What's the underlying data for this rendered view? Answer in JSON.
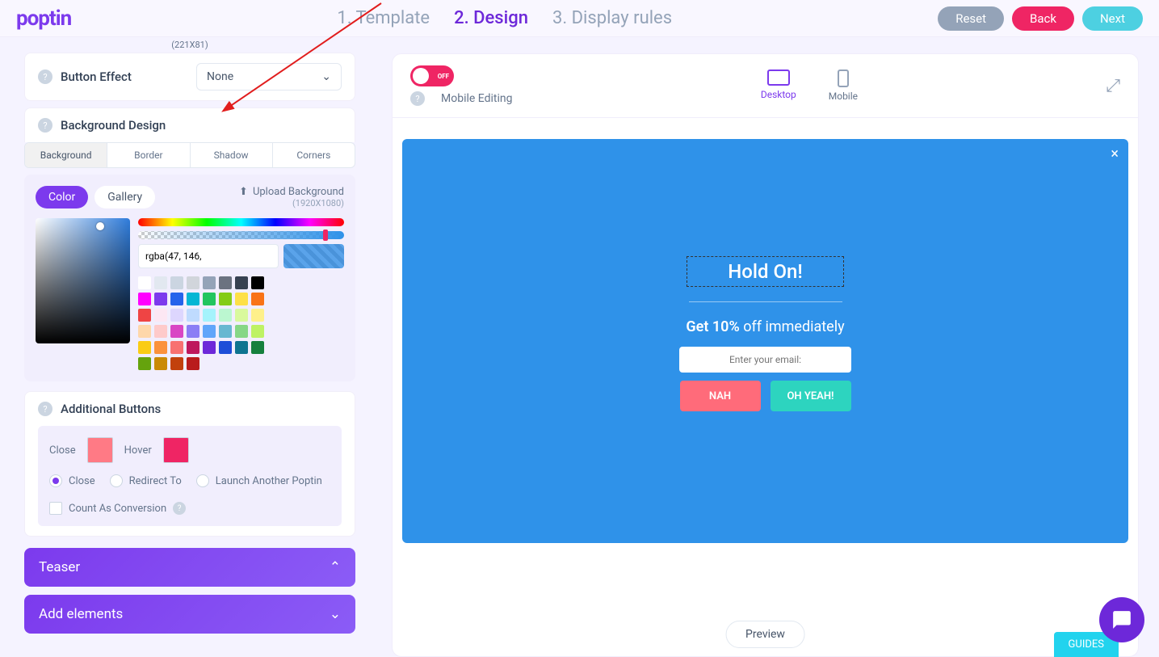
{
  "header": {
    "logo": "poptin",
    "steps": [
      "1. Template",
      "2. Design",
      "3. Display rules"
    ],
    "activeStep": 1,
    "reset": "Reset",
    "back": "Back",
    "next": "Next"
  },
  "sidebar": {
    "sizeHint": "(221X81)",
    "buttonEffect": {
      "label": "Button Effect",
      "value": "None"
    },
    "backgroundDesign": {
      "label": "Background Design",
      "tabs": [
        "Background",
        "Border",
        "Shadow",
        "Corners"
      ],
      "activeTab": 0,
      "colorChip": "Color",
      "galleryChip": "Gallery",
      "uploadLabel": "Upload Background",
      "uploadHint": "(1920X1080)",
      "colorValue": "rgba(47, 146,",
      "swatches": [
        "#ffffff",
        "#e2e8f0",
        "#cbd5e1",
        "#d1d5db",
        "#94a3b8",
        "#6b7280",
        "#374151",
        "#000000",
        "#ff00ff",
        "#7c3aed",
        "#2563eb",
        "#06b6d4",
        "#22c55e",
        "#84cc16",
        "#fde047",
        "#f97316",
        "#ef4444",
        "#fce7f3",
        "#ddd6fe",
        "#bfdbfe",
        "#a5f3fc",
        "#bbf7d0",
        "#d9f99d",
        "#fef08a",
        "#fed7aa",
        "#fecaca",
        "#d946c4",
        "#8b7ef5",
        "#60a5fa",
        "#67b7d1",
        "#86d786",
        "#bef264",
        "#facc15",
        "#fb923c",
        "#f87171",
        "#be185d",
        "#6d28d9",
        "#1d4ed8",
        "#0e7490",
        "#15803d",
        "#65a30d",
        "#ca8a04",
        "#c2410c",
        "#b91c1c"
      ]
    },
    "additionalButtons": {
      "label": "Additional Buttons",
      "closeLabel": "Close",
      "closeColor": "#ff7a85",
      "hoverLabel": "Hover",
      "hoverColor": "#ef2564",
      "radios": {
        "close": "Close",
        "redirect": "Redirect To",
        "launch": "Launch Another Poptin",
        "count": "Count As Conversion"
      }
    },
    "teaser": "Teaser",
    "addElements": "Add elements"
  },
  "canvas": {
    "toggleLabel": "OFF",
    "mobileEditing": "Mobile Editing",
    "desktop": "Desktop",
    "mobile": "Mobile",
    "popup": {
      "title": "Hold On!",
      "subtitleBold": "Get 10%",
      "subtitleRest": " off immediately",
      "emailPlaceholder": "Enter your email:",
      "nah": "NAH",
      "yeah": "OH YEAH!"
    },
    "preview": "Preview",
    "guides": "GUIDES"
  }
}
